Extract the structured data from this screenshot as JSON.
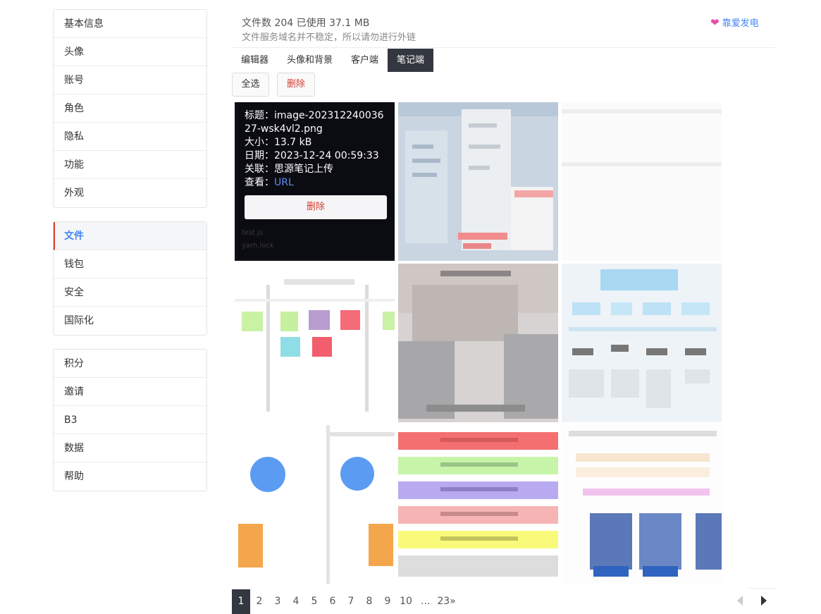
{
  "sidebar": {
    "group1": [
      "基本信息",
      "头像",
      "账号",
      "角色",
      "隐私",
      "功能",
      "外观"
    ],
    "group2": [
      "文件",
      "钱包",
      "安全",
      "国际化"
    ],
    "group3": [
      "积分",
      "邀请",
      "B3",
      "数据",
      "帮助"
    ],
    "active": "文件"
  },
  "header": {
    "stats": "文件数 204 已使用 37.1 MB",
    "notice": "文件服务域名并不稳定，所以请勿进行外链",
    "sponsor": "靠爱发电",
    "sponsor_icon": "heart-icon"
  },
  "tabs": [
    {
      "label": "编辑器",
      "active": false
    },
    {
      "label": "头像和背景",
      "active": false
    },
    {
      "label": "客户端",
      "active": false
    },
    {
      "label": "笔记端",
      "active": true
    }
  ],
  "toolbar": {
    "select_all": "全选",
    "delete": "删除"
  },
  "tooltip": {
    "title_label": "标题：",
    "title_value": "image-20231224003627-wsk4vl2.png",
    "size_label": "大小：",
    "size_value": "13.7 kB",
    "date_label": "日期：",
    "date_value": "2023-12-24 00:59:33",
    "rel_label": "关联：",
    "rel_value": "思源笔记上传",
    "view_label": "查看：",
    "view_link": "URL",
    "delete": "删除",
    "ghost_lines": [
      "test.js",
      "yarn.lock"
    ]
  },
  "pagination": {
    "pages": [
      "1",
      "2",
      "3",
      "4",
      "5",
      "6",
      "7",
      "8",
      "9",
      "10"
    ],
    "ellipsis": "...",
    "last": "23»",
    "current": "1"
  },
  "colors": {
    "accent": "#4285f4",
    "danger": "#d23f31",
    "dark": "#333740",
    "heart": "#ea4aaa"
  }
}
